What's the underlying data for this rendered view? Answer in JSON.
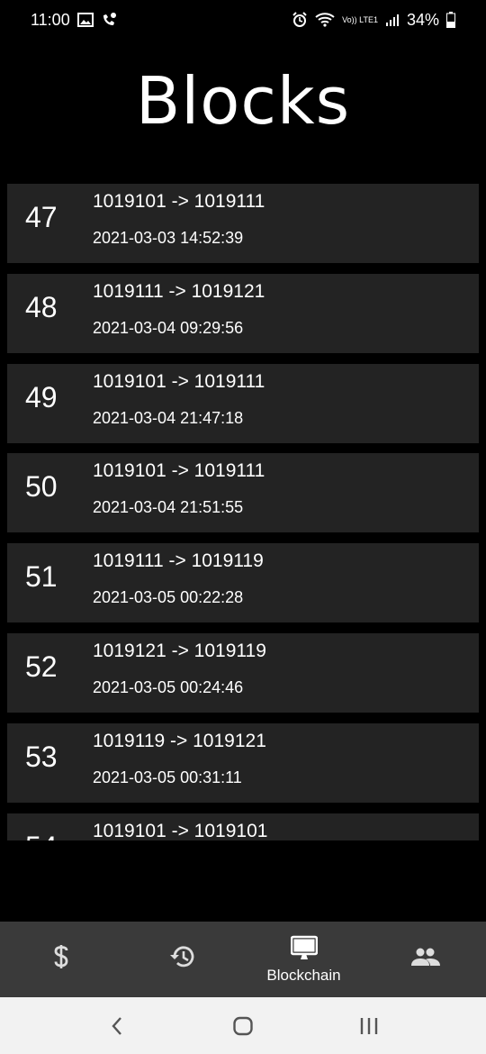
{
  "status_bar": {
    "time": "11:00",
    "battery": "34%",
    "network_label": "Vo)) LTE1"
  },
  "page": {
    "title": "Blocks"
  },
  "blocks": [
    {
      "number": "47",
      "transfer": "1019101 -> 1019111",
      "timestamp": "2021-03-03 14:52:39"
    },
    {
      "number": "48",
      "transfer": "1019111 -> 1019121",
      "timestamp": "2021-03-04 09:29:56"
    },
    {
      "number": "49",
      "transfer": "1019101 -> 1019111",
      "timestamp": "2021-03-04 21:47:18"
    },
    {
      "number": "50",
      "transfer": "1019101 -> 1019111",
      "timestamp": "2021-03-04 21:51:55"
    },
    {
      "number": "51",
      "transfer": "1019111 -> 1019119",
      "timestamp": "2021-03-05 00:22:28"
    },
    {
      "number": "52",
      "transfer": "1019121 -> 1019119",
      "timestamp": "2021-03-05 00:24:46"
    },
    {
      "number": "53",
      "transfer": "1019119 -> 1019121",
      "timestamp": "2021-03-05 00:31:11"
    },
    {
      "number": "54",
      "transfer": "1019101 -> 1019101",
      "timestamp": ""
    }
  ],
  "bottom_nav": {
    "items": [
      {
        "icon": "dollar-icon",
        "label": ""
      },
      {
        "icon": "history-icon",
        "label": ""
      },
      {
        "icon": "monitor-icon",
        "label": "Blockchain"
      },
      {
        "icon": "people-icon",
        "label": ""
      }
    ],
    "active_index": 2
  },
  "system_nav": {
    "buttons": [
      "back",
      "home",
      "recents"
    ]
  },
  "colors": {
    "background": "#000000",
    "card": "#232323",
    "nav_bar": "#3a3a3a",
    "system_nav": "#f2f2f2"
  }
}
